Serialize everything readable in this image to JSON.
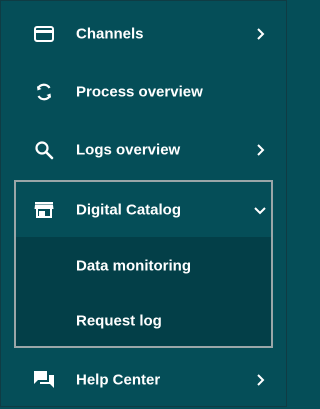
{
  "nav": {
    "channels": {
      "label": "Channels",
      "icon": "card-icon",
      "has_chevron": true
    },
    "process_overview": {
      "label": "Process overview",
      "icon": "sync-icon",
      "has_chevron": false
    },
    "logs_overview": {
      "label": "Logs overview",
      "icon": "search-icon",
      "has_chevron": true
    },
    "digital_catalog": {
      "label": "Digital Catalog",
      "icon": "store-icon",
      "expanded": true,
      "children": [
        {
          "label": "Data monitoring"
        },
        {
          "label": "Request log"
        }
      ]
    },
    "help_center": {
      "label": "Help Center",
      "icon": "chat-icon",
      "has_chevron": true
    }
  },
  "colors": {
    "background": "#054e58",
    "submenu_background": "#033f48",
    "group_border": "#9aa6a8",
    "text": "#ffffff"
  }
}
